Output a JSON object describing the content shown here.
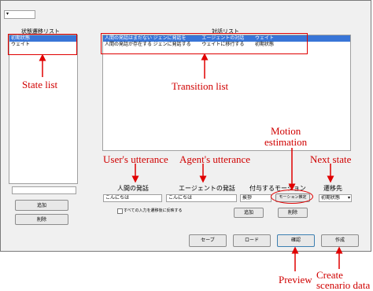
{
  "window": {
    "dropdown_value": "",
    "state_list": {
      "header": "状態遷移リスト",
      "items": [
        {
          "label": "初期状態",
          "selected": true
        },
        {
          "label": "ウェイト",
          "selected": false
        }
      ]
    },
    "transition_list": {
      "header": "対話リスト",
      "rows": [
        {
          "c1": "人間の発話はまだない",
          "c2": "ジェンに発話を",
          "c3": "エージェントの対話",
          "c4": "ウェイト",
          "selected": true
        },
        {
          "c1": "人間の発話が存在する",
          "c2": "ジェンに発話する",
          "c3": "ウェイトに移行する",
          "c4": "初期状態",
          "selected": false
        }
      ]
    },
    "left_buttons": {
      "add": "追加",
      "delete": "削除"
    },
    "edit": {
      "user_utterance_label": "人間の発話",
      "agent_utterance_label": "エージェントの発話",
      "motion_label": "付与するモーション",
      "next_state_label": "遷移先",
      "user_utterance_value": "こんにちは",
      "agent_utterance_value": "こんにちは",
      "motion_value": "挨拶",
      "motion_button": "モーション推定",
      "next_state_value": "初期状態",
      "checkbox_label": "すべての入力を遷移後に反映する",
      "add_button": "追加",
      "delete_button": "削除"
    },
    "bottom_buttons": {
      "save": "セーブ",
      "load": "ロード",
      "preview": "確認",
      "create": "作成"
    }
  },
  "annotations": {
    "state_list": "State list",
    "transition_list": "Transition list",
    "users_utterance": "User's utterance",
    "agents_utterance": "Agent's utterance",
    "motion_estimation": "Motion\nestimation",
    "next_state": "Next state",
    "preview": "Preview",
    "create_scenario": "Create\nscenario data"
  },
  "colors": {
    "annotation": "#e00000",
    "selection": "#3875d7"
  }
}
